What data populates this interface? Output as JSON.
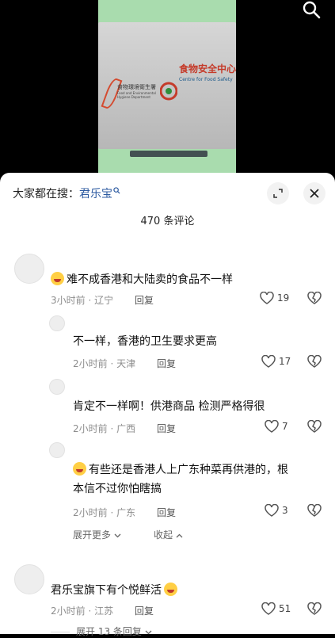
{
  "video": {
    "sign_left_line1": "食物環境衛生署",
    "sign_left_line2": "Food and Environmental",
    "sign_left_line3": "Hygiene Department",
    "sign_right_line1": "食物安全中心",
    "sign_right_line2": "Centre for Food Safety"
  },
  "sheet": {
    "search_prefix": "大家都在搜：",
    "search_term": "君乐宝",
    "comment_count": "470 条评论"
  },
  "comments": [
    {
      "text": "难不成香港和大陆卖的食品不一样",
      "time": "3小时前 · 辽宁",
      "reply": "回复",
      "likes": "19"
    },
    {
      "text": "不一样，香港的卫生要求更高",
      "time": "2小时前 · 天津",
      "reply": "回复",
      "likes": "17"
    },
    {
      "text": "肯定不一样啊！供港商品 检测严格得很",
      "time": "2小时前 · 广西",
      "reply": "回复",
      "likes": "7"
    },
    {
      "text_line1": "有些还是香港人上广东种菜再供港的，根",
      "text_line2": "本信不过你怕瞎搞",
      "time": "2小时前 · 广东",
      "reply": "回复",
      "likes": "3"
    },
    {
      "text": "君乐宝旗下有个悦鲜活",
      "time": "2小时前 · 江苏",
      "reply": "回复",
      "likes": "51"
    }
  ],
  "thread_controls": {
    "expand_more": "展开更多",
    "collapse": "收起",
    "expand_13": "展开 13 条回复"
  },
  "colors": {
    "link": "#2c5aa0",
    "meta": "#8d8d8d"
  }
}
